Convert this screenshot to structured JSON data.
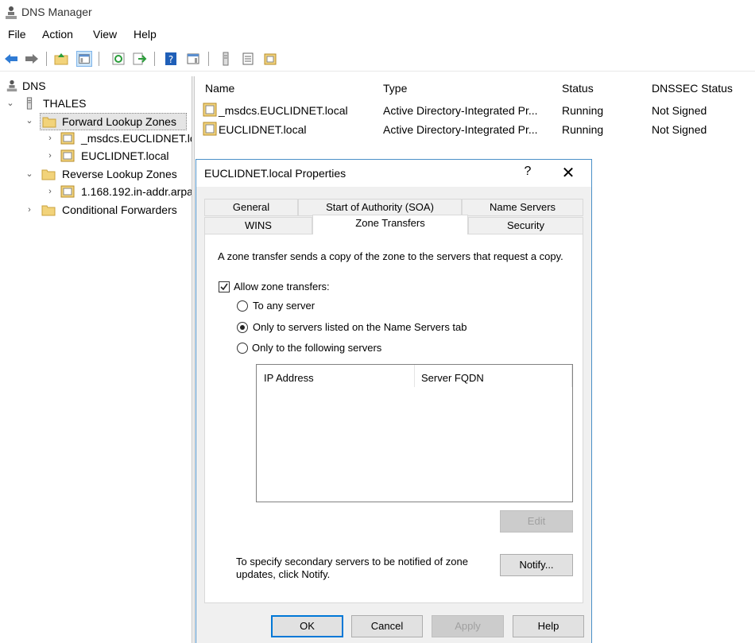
{
  "window": {
    "title": "DNS Manager"
  },
  "menu": [
    "File",
    "Action",
    "View",
    "Help"
  ],
  "tree": {
    "root": "DNS",
    "server": "THALES",
    "forward": "Forward Lookup Zones",
    "fwd_zone1": "_msdcs.EUCLIDNET.lo",
    "fwd_zone2": "EUCLIDNET.local",
    "reverse": "Reverse Lookup Zones",
    "rev_zone1": "1.168.192.in-addr.arpa",
    "conditional": "Conditional Forwarders"
  },
  "list": {
    "headers": {
      "name": "Name",
      "type": "Type",
      "status": "Status",
      "dnssec": "DNSSEC Status"
    },
    "rows": [
      {
        "name": "_msdcs.EUCLIDNET.local",
        "type": "Active Directory-Integrated Pr...",
        "status": "Running",
        "dnssec": "Not Signed"
      },
      {
        "name": "EUCLIDNET.local",
        "type": "Active Directory-Integrated Pr...",
        "status": "Running",
        "dnssec": "Not Signed"
      }
    ]
  },
  "dialog": {
    "title": "EUCLIDNET.local Properties",
    "help": "?",
    "close": "✕",
    "tabs": {
      "general": "General",
      "soa": "Start of Authority (SOA)",
      "name_servers": "Name Servers",
      "wins": "WINS",
      "zone_transfers": "Zone Transfers",
      "security": "Security"
    },
    "description": "A zone transfer sends a copy of the zone to the servers that request a copy.",
    "allow_label": "Allow zone transfers:",
    "allow_checked": true,
    "option_any": "To any server",
    "option_ns": "Only to servers listed on the Name Servers tab",
    "option_following": "Only to the following servers",
    "selected_option": "ns",
    "server_list": {
      "col_ip": "IP Address",
      "col_fqdn": "Server FQDN"
    },
    "edit": "Edit",
    "notify_text_1": "To specify secondary servers to be notified of zone",
    "notify_text_2": "updates, click Notify.",
    "notify": "Notify...",
    "ok": "OK",
    "cancel": "Cancel",
    "apply": "Apply",
    "help_btn": "Help"
  },
  "colors": {
    "folder": "#f2d37a",
    "accent": "#0078d7",
    "selection": "#e5e5e5"
  }
}
